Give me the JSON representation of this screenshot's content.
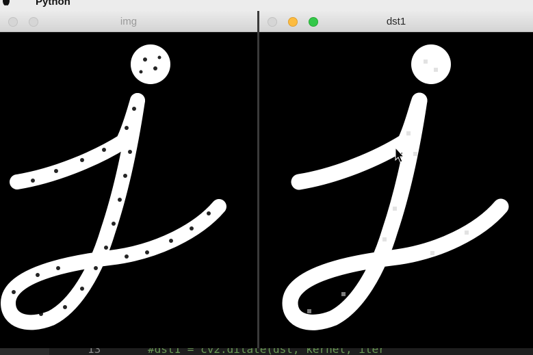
{
  "menubar": {
    "app_name": "Python"
  },
  "windows": [
    {
      "title": "img",
      "active": false
    },
    {
      "title": "dst1",
      "active": true
    }
  ],
  "editor": {
    "line_number": "13",
    "code_line": "#dst1 = cv2.dilate(dst, kernel, iter"
  },
  "colors": {
    "close": "#fc605c",
    "minimize": "#fdbc40",
    "zoom": "#34c84a",
    "inactive_button": "#d6d6d6",
    "canvas_background": "#000000",
    "stroke": "#ffffff",
    "comment": "#6a9955"
  },
  "icons": {
    "apple": "apple-logo-icon",
    "cursor": "mouse-pointer-icon"
  }
}
